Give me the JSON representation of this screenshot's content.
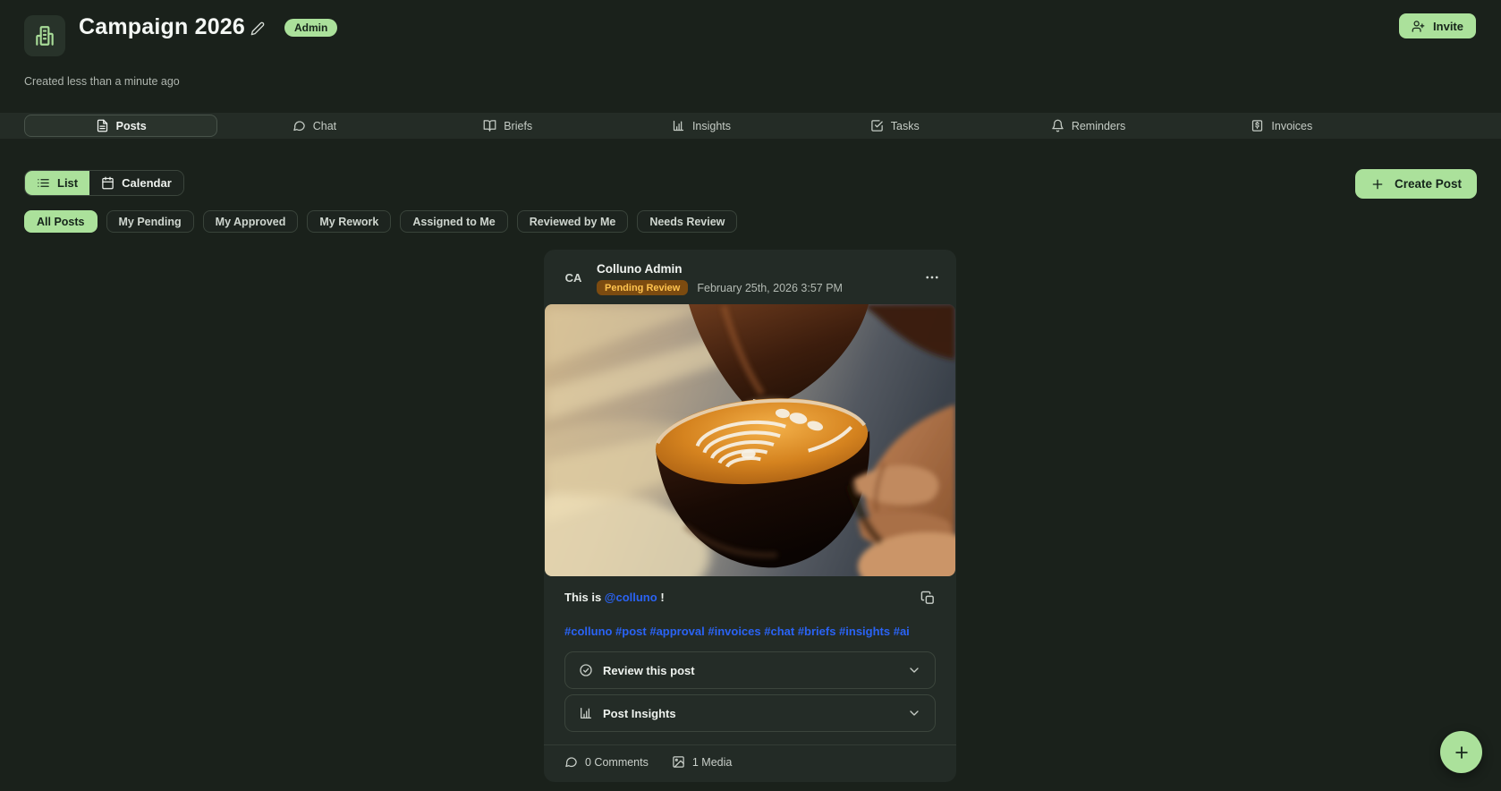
{
  "header": {
    "title": "Campaign 2026",
    "badge": "Admin",
    "created": "Created less than a minute ago",
    "invite_label": "Invite"
  },
  "tabs": [
    {
      "label": "Posts",
      "icon": "file-text-icon",
      "active": true
    },
    {
      "label": "Chat",
      "icon": "message-icon",
      "active": false
    },
    {
      "label": "Briefs",
      "icon": "book-open-icon",
      "active": false
    },
    {
      "label": "Insights",
      "icon": "bar-chart-icon",
      "active": false
    },
    {
      "label": "Tasks",
      "icon": "check-square-icon",
      "active": false
    },
    {
      "label": "Reminders",
      "icon": "bell-icon",
      "active": false
    },
    {
      "label": "Invoices",
      "icon": "invoice-icon",
      "active": false
    }
  ],
  "toolbar": {
    "view_list_label": "List",
    "view_calendar_label": "Calendar",
    "create_post_label": "Create Post"
  },
  "filters": [
    {
      "label": "All Posts",
      "active": true
    },
    {
      "label": "My Pending",
      "active": false
    },
    {
      "label": "My Approved",
      "active": false
    },
    {
      "label": "My Rework",
      "active": false
    },
    {
      "label": "Assigned to Me",
      "active": false
    },
    {
      "label": "Reviewed by Me",
      "active": false
    },
    {
      "label": "Needs Review",
      "active": false
    }
  ],
  "post": {
    "avatar_initials": "CA",
    "author": "Colluno Admin",
    "status": "Pending Review",
    "timestamp": "February 25th, 2026 3:57 PM",
    "body_prefix": "This is ",
    "mention": "@colluno",
    "body_suffix": " !",
    "hashtags": "#colluno #post #approval #invoices #chat #briefs #insights #ai",
    "media_alt": "latte-art-coffee-pour-photo",
    "review_section_label": "Review this post",
    "insights_section_label": "Post Insights",
    "comments_label": "0 Comments",
    "media_label": "1 Media"
  },
  "colors": {
    "accent_green": "#abe19b",
    "page_background": "#1a211b",
    "card_background": "#232b26",
    "status_badge_bg": "#7c4b10",
    "status_badge_text": "#ffc34e",
    "link_blue": "#2a63f4"
  }
}
